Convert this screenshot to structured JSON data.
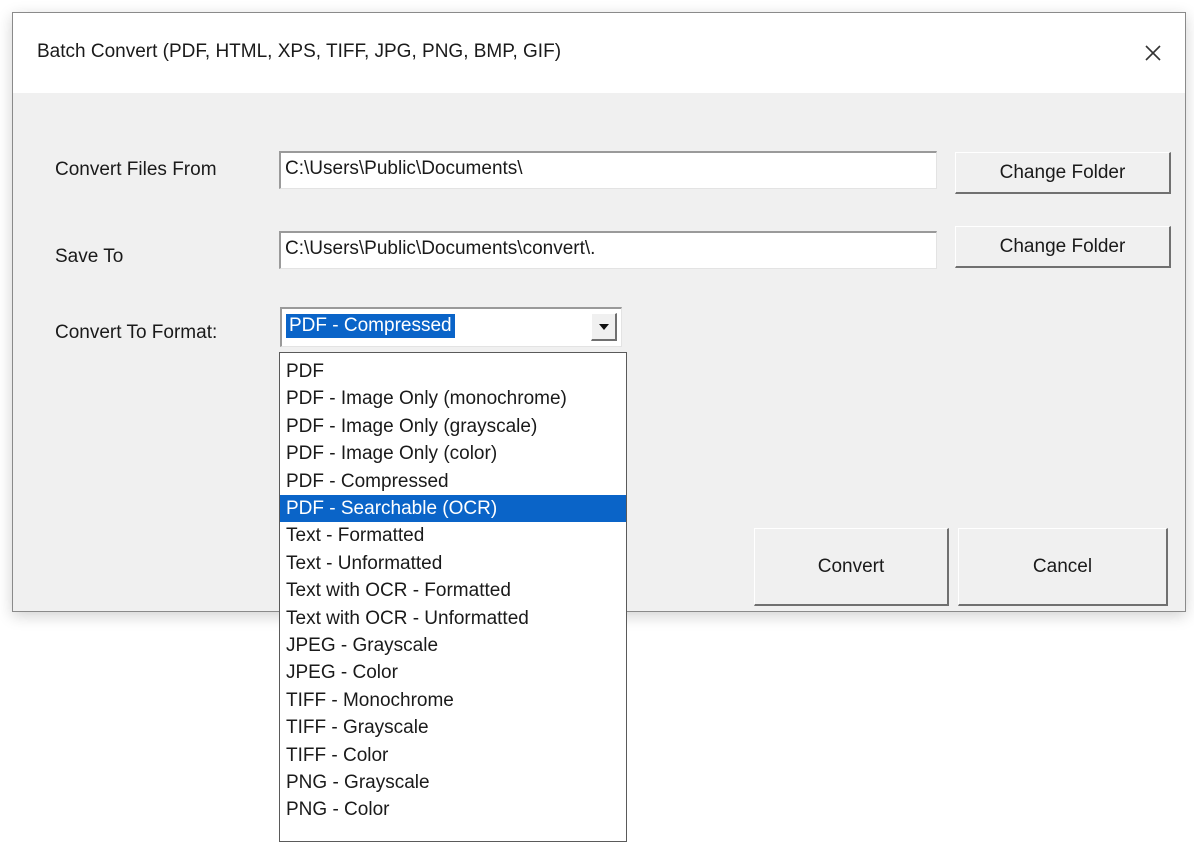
{
  "dialog": {
    "title": "Batch Convert (PDF, HTML, XPS, TIFF, JPG, PNG, BMP, GIF)",
    "close_icon": "close-icon"
  },
  "form": {
    "from_label": "Convert Files From",
    "from_value": "C:\\Users\\Public\\Documents\\",
    "save_label": "Save To",
    "save_value": "C:\\Users\\Public\\Documents\\convert\\.",
    "change_folder_label": "Change Folder",
    "format_label": "Convert To Format:",
    "format_value": "PDF - Compressed"
  },
  "buttons": {
    "convert": "Convert",
    "cancel": "Cancel"
  },
  "format_options": [
    "PDF",
    "PDF - Image Only (monochrome)",
    "PDF - Image Only (grayscale)",
    "PDF - Image Only (color)",
    "PDF - Compressed",
    "PDF - Searchable (OCR)",
    "Text - Formatted",
    "Text - Unformatted",
    "Text with OCR - Formatted",
    "Text with OCR - Unformatted",
    "JPEG - Grayscale",
    "JPEG - Color",
    "TIFF - Monochrome",
    "TIFF - Grayscale",
    "TIFF - Color",
    "PNG - Grayscale",
    "PNG - Color"
  ],
  "highlighted_option": "PDF - Searchable (OCR)",
  "colors": {
    "selection": "#0a64c8",
    "dialog_bg": "#f0f0f0"
  }
}
